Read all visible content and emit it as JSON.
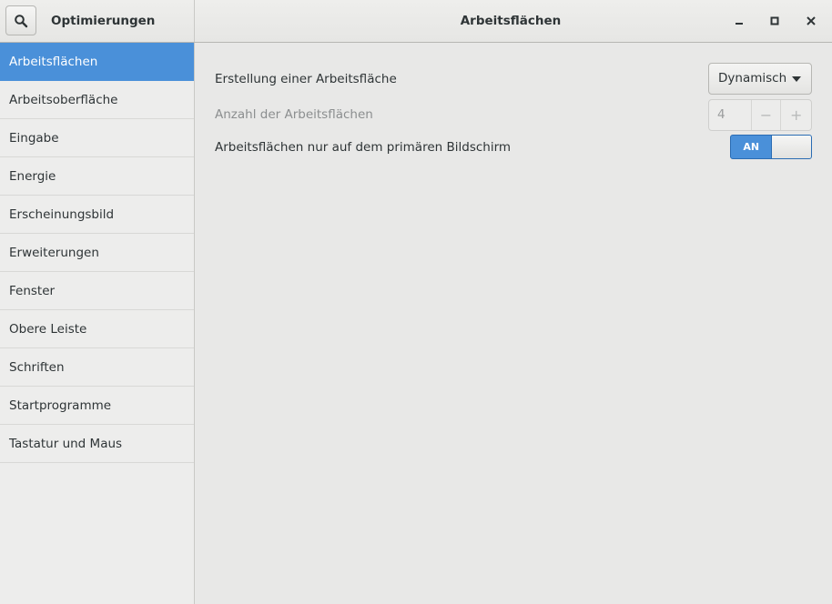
{
  "header": {
    "app_title": "Optimierungen",
    "window_title": "Arbeitsflächen",
    "search_icon": "search-icon",
    "minimize_icon": "minimize-icon",
    "maximize_icon": "maximize-icon",
    "close_icon": "close-icon"
  },
  "sidebar": {
    "items": [
      {
        "label": "Arbeitsflächen",
        "selected": true
      },
      {
        "label": "Arbeitsoberfläche"
      },
      {
        "label": "Eingabe"
      },
      {
        "label": "Energie"
      },
      {
        "label": "Erscheinungsbild"
      },
      {
        "label": "Erweiterungen"
      },
      {
        "label": "Fenster"
      },
      {
        "label": "Obere Leiste"
      },
      {
        "label": "Schriften"
      },
      {
        "label": "Startprogramme"
      },
      {
        "label": "Tastatur und Maus"
      }
    ]
  },
  "main": {
    "creation": {
      "label": "Erstellung einer Arbeitsfläche",
      "value": "Dynamisch"
    },
    "count": {
      "label": "Anzahl der Arbeitsflächen",
      "value": "4",
      "minus": "−",
      "plus": "+",
      "disabled": true
    },
    "primary_only": {
      "label": "Arbeitsflächen nur auf dem primären Bildschirm",
      "switch_text": "AN",
      "on": true
    }
  },
  "colors": {
    "accent": "#4a90d9",
    "background": "#e8e8e7"
  }
}
